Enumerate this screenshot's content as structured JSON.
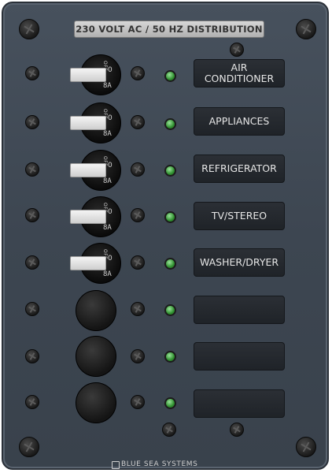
{
  "panel": {
    "title": "230 VOLT AC / 50 HZ DISTRIBUTION",
    "brand": "BLUE SEA SYSTEMS"
  },
  "circuits": [
    {
      "label_line1": "AIR",
      "label_line2": "CONDITIONER",
      "breaker": {
        "state": "OFF",
        "zero": "0",
        "rating": "8A"
      }
    },
    {
      "label_line1": "APPLIANCES",
      "label_line2": "",
      "breaker": {
        "state": "OFF",
        "zero": "0",
        "rating": "8A"
      }
    },
    {
      "label_line1": "REFRIGERATOR",
      "label_line2": "",
      "breaker": {
        "state": "OFF",
        "zero": "0",
        "rating": "8A"
      }
    },
    {
      "label_line1": "TV/STEREO",
      "label_line2": "",
      "breaker": {
        "state": "OFF",
        "zero": "0",
        "rating": "8A"
      }
    },
    {
      "label_line1": "WASHER/DRYER",
      "label_line2": "",
      "breaker": {
        "state": "OFF",
        "zero": "0",
        "rating": "8A"
      }
    },
    {
      "label_line1": "",
      "label_line2": "",
      "breaker": null
    },
    {
      "label_line1": "",
      "label_line2": "",
      "breaker": null
    },
    {
      "label_line1": "",
      "label_line2": "",
      "breaker": null
    }
  ],
  "colors": {
    "panel": "#3f4954",
    "led": "#2f8f2f",
    "label_plate": "#23272c",
    "title_plate": "#c4c4c4"
  }
}
